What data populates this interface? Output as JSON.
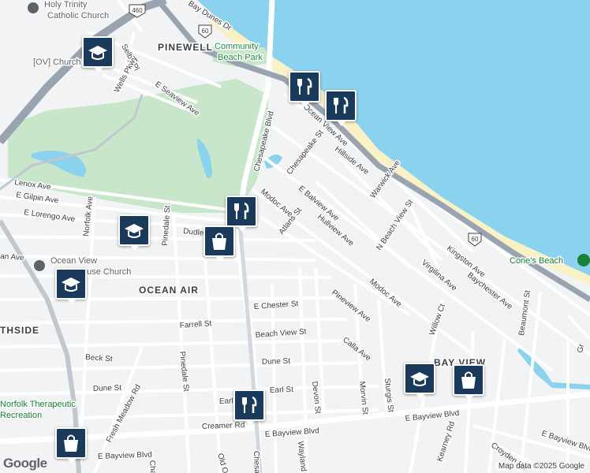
{
  "map": {
    "attribution": "Map data ©2025 Google",
    "logo": "Google",
    "colors": {
      "water": "#8ad2ed",
      "land": "#f1f3f4",
      "park": "#c8e6c9",
      "beach": "#fbf1c7",
      "highway": "#9aa4b1",
      "road": "#ffffff",
      "pin": "#1a3a5c"
    },
    "areas": {
      "pinewell": "PINEWELL",
      "ocean_air": "OCEAN AIR",
      "bay_view": "BAY VIEW",
      "southside": "THSIDE"
    },
    "parks": {
      "community_beach_1": "Community",
      "community_beach_2": "Beach Park"
    },
    "pois": {
      "holy_trinity": "Holy Trinity",
      "catholic_church": "Catholic Church",
      "ov_church": "[OV] Church",
      "ocean_view_1": "Ocean View",
      "ocean_view_2": "Lighthouse Church",
      "norfolk_therapeutic_1": "Norfolk Therapeutic",
      "norfolk_therapeutic_2": "Recreation",
      "cones_beach": "Cone's Beach"
    },
    "shields": {
      "us60_a": "60",
      "us60_b": "60",
      "us460": "460"
    },
    "streets": {
      "bay_dunes": "Bay Dunes Dr",
      "selby": "Selby Pl",
      "wells": "Wells Pkwy",
      "e_seaview": "E Seaview Ave",
      "ocean_view_ave": "Ocean View Ave",
      "chesapeake_blvd": "Chesapeake Blvd",
      "chesapeake_st": "Chesapeake St",
      "hillside": "Hillside Ave",
      "warwick": "Warwick Ave",
      "lenox": "Lenox Ave",
      "gilpin": "E Gilpin Ave",
      "lorengo": "E Lorengo Ave",
      "norfolk_ave": "Norfolk Ave",
      "modoc1": "Modoc Ave",
      "e_balview": "E Balview Ave",
      "atlans": "Atlans St",
      "hullview": "Hullview Ave",
      "n_beach_view": "N Beach View St",
      "dudley": "Dudle",
      "pinedale1": "Pinedale St",
      "kingston": "Kingston Ave",
      "baychester": "Baychester Ave",
      "virginia": "Virgilina Ave",
      "modoc2": "Modoc Ave",
      "willow": "Willow Ct",
      "beaumont": "Beaumont St",
      "e_chester": "E Chester St",
      "farrell": "Farrell St",
      "beach_view": "Beach View St",
      "pineview": "Pineview Ave",
      "calla": "Calla Ave",
      "beck": "Beck St",
      "pinedale2": "Pinedale St",
      "dune1": "Dune St",
      "dune2": "Dune St",
      "fresh_meadow": "Fresh Meadow Rd",
      "earl1": "Earl St",
      "earl2": "Earl St",
      "devon": "Devon St",
      "morvin": "Morvin St",
      "sturgis": "Sturgis St",
      "creamer": "Creamer Rd",
      "e_bayview1": "E Bayview Blvd",
      "e_bayview2": "E Bayview Blvd",
      "e_bayview3": "E Bayview Blvd",
      "e_bayview4": "E Bayview Blvd",
      "wayland": "Wayland",
      "kearney": "Kearney Rd",
      "croyden": "Croyden Rd",
      "old_ocean": "Old Oc",
      "ches_cut": "Chesa",
      "cha": "Cha",
      "an_ave": "an Ave",
      "gr": "Gr"
    },
    "markers": [
      {
        "id": "school",
        "icon": "school-icon"
      },
      {
        "id": "restaurant",
        "icon": "restaurant-icon"
      },
      {
        "id": "shopping",
        "icon": "shopping-bag-icon"
      }
    ]
  }
}
